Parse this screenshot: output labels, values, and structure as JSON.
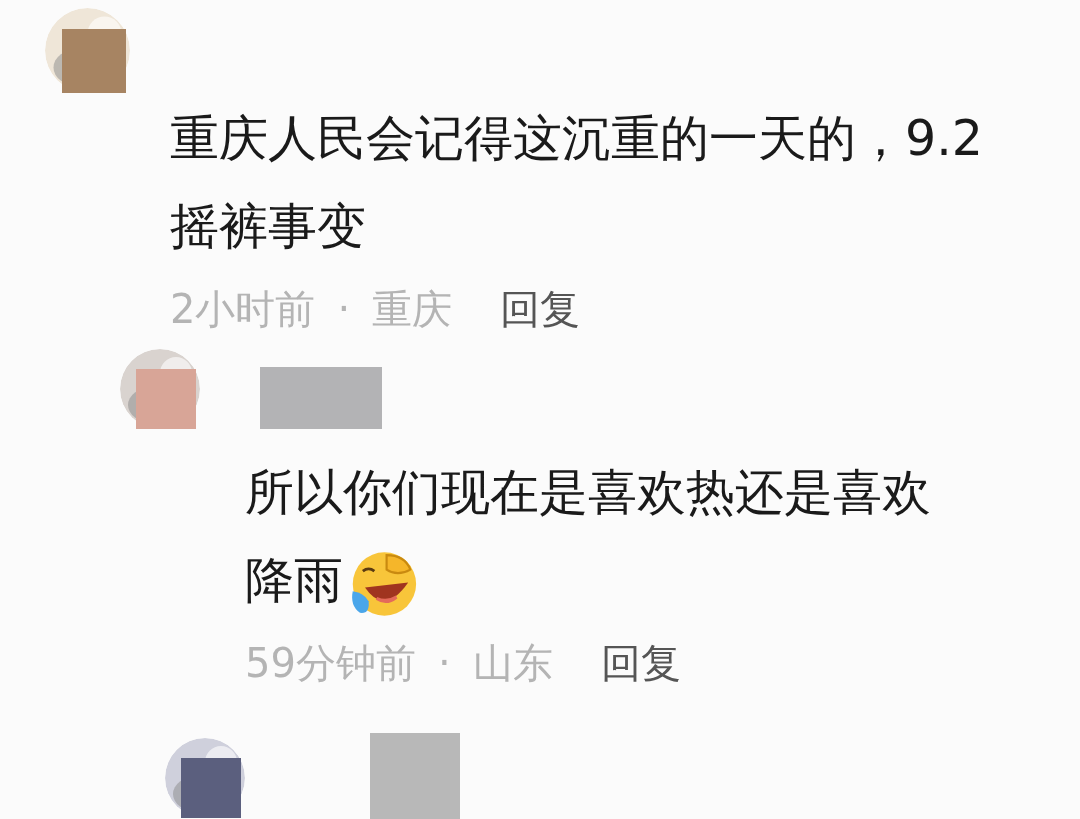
{
  "comments": [
    {
      "kind": "comment",
      "text": "重庆人民会记得这沉重的一天的，9.2摇裤事变",
      "time": "2小时前",
      "separator": "·",
      "location": "重庆",
      "reply": "回复",
      "emoji": false,
      "replies": [
        {
          "kind": "comment",
          "text": "所以你们现在是喜欢热还是喜欢降雨",
          "time": "59分钟前",
          "separator": "·",
          "location": "山东",
          "reply": "回复",
          "emoji": true
        },
        {
          "kind": "cut_off"
        }
      ]
    }
  ]
}
